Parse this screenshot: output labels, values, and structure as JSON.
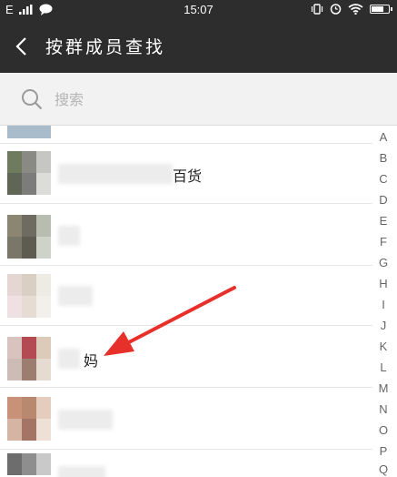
{
  "status_bar": {
    "carrier": "E",
    "time": "15:07"
  },
  "header": {
    "title": "按群成员查找"
  },
  "search": {
    "placeholder": "搜索"
  },
  "members": [
    {
      "name": ""
    },
    {
      "name": "百货"
    },
    {
      "name": ""
    },
    {
      "name": ""
    },
    {
      "name": "妈"
    },
    {
      "name": ""
    },
    {
      "name": ""
    }
  ],
  "index_letters": [
    "A",
    "B",
    "C",
    "D",
    "E",
    "F",
    "G",
    "H",
    "I",
    "J",
    "K",
    "L",
    "M",
    "N",
    "O",
    "P",
    "Q"
  ],
  "colors": {
    "header_bg": "#2d2d2d",
    "arrow": "#e8302a",
    "search_bg": "#f2f2f2"
  }
}
